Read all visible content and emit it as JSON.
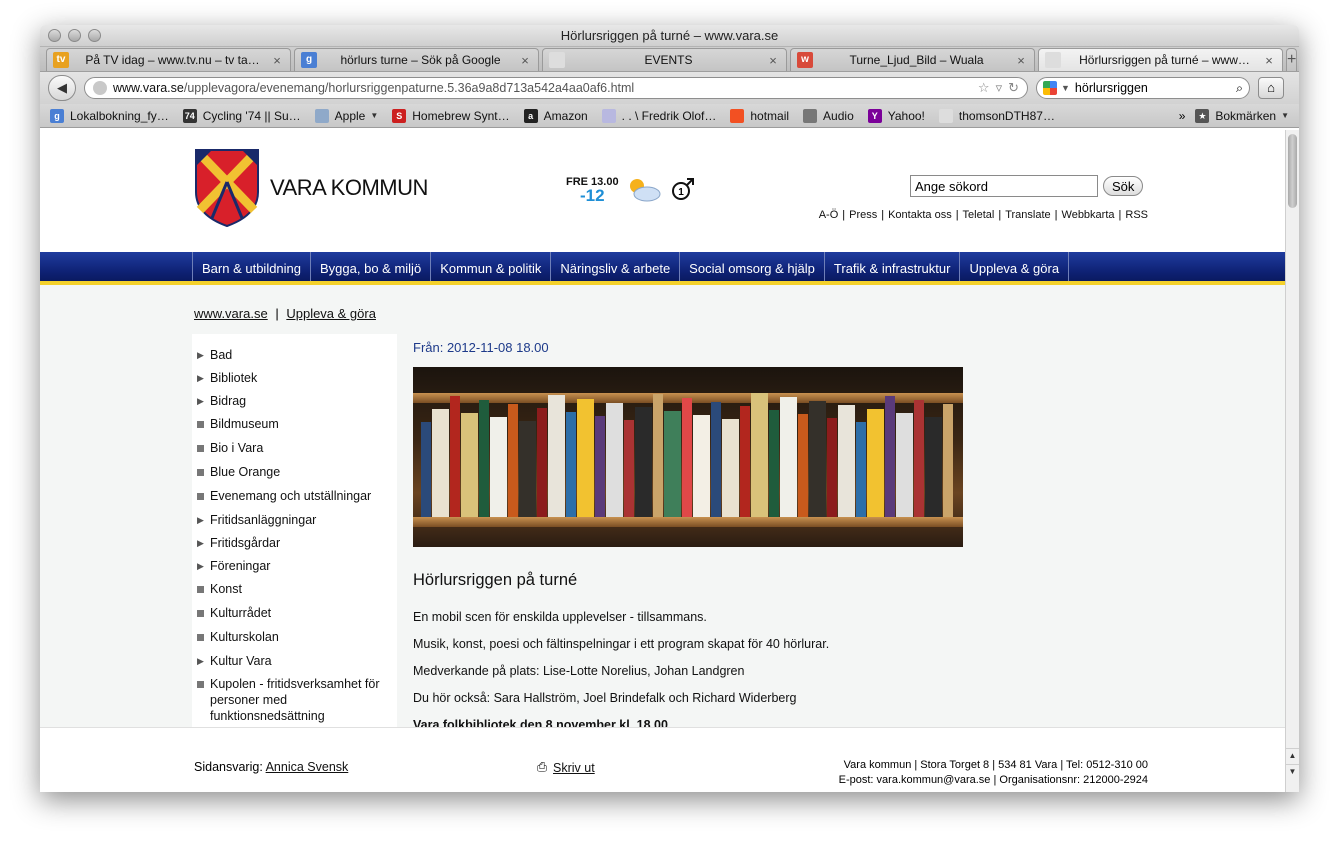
{
  "window": {
    "title": "Hörlursriggen på turné – www.vara.se"
  },
  "tabs": [
    {
      "label": "På TV idag – www.tv.nu – tv ta…",
      "icon": "tv-icon",
      "color": "#e8a120",
      "glyph": "tv"
    },
    {
      "label": "hörlurs turne – Sök på Google",
      "icon": "google-icon",
      "color": "#4a7fd4",
      "glyph": "g"
    },
    {
      "label": "EVENTS",
      "icon": "blank-page-icon",
      "color": "#dddddd",
      "glyph": ""
    },
    {
      "label": "Turne_Ljud_Bild – Wuala",
      "icon": "wuala-icon",
      "color": "#d84a3a",
      "glyph": "w"
    },
    {
      "label": "Hörlursriggen på turné – www…",
      "icon": "blank-page-icon",
      "color": "#dddddd",
      "glyph": ""
    }
  ],
  "navbar": {
    "url_host": "www.vara.se",
    "url_path": "/upplevagora/evenemang/horlursriggenpaturne.5.36a9a8d713a542a4aa0af6.html",
    "search_value": "hörlursriggen"
  },
  "bookmarks": [
    {
      "label": "Lokalbokning_fy…",
      "icon": "google-icon",
      "color": "#4a7fd4",
      "glyph": "g"
    },
    {
      "label": "Cycling '74 || Su…",
      "icon": "cycling74-icon",
      "color": "#333333",
      "glyph": "74"
    },
    {
      "label": "Apple",
      "icon": "folder-icon",
      "color": "#8fa9c9",
      "glyph": "",
      "dropdown": true
    },
    {
      "label": "Homebrew Synt…",
      "icon": "homebrew-icon",
      "color": "#cc1f1f",
      "glyph": "S"
    },
    {
      "label": "Amazon",
      "icon": "amazon-icon",
      "color": "#222222",
      "glyph": "a"
    },
    {
      "label": ". . \\ Fredrik Olof…",
      "icon": "page-icon",
      "color": "#b8b8e0",
      "glyph": ""
    },
    {
      "label": "hotmail",
      "icon": "windows-icon",
      "color": "#f25022",
      "glyph": ""
    },
    {
      "label": "Audio",
      "icon": "apple-icon",
      "color": "#777777",
      "glyph": ""
    },
    {
      "label": "Yahoo!",
      "icon": "yahoo-icon",
      "color": "#7b0099",
      "glyph": "Y"
    },
    {
      "label": "thomsonDTH87…",
      "icon": "blank-page-icon",
      "color": "#dddddd",
      "glyph": ""
    }
  ],
  "bookmarks_menu": "Bokmärken",
  "overflow": "»",
  "site": {
    "brand": "VARA KOMMUN",
    "weather": {
      "day": "FRE 13.00",
      "temp": "-12",
      "wind": "1"
    },
    "search_placeholder": "Ange sökord",
    "search_button": "Sök",
    "toplinks": [
      "A-Ö",
      "Press",
      "Kontakta oss",
      "Teletal",
      "Translate",
      "Webbkarta",
      "RSS"
    ],
    "mainnav": [
      "Barn & utbildning",
      "Bygga, bo & miljö",
      "Kommun & politik",
      "Näringsliv & arbete",
      "Social omsorg & hjälp",
      "Trafik & infrastruktur",
      "Uppleva & göra"
    ],
    "breadcrumb": {
      "home": "www.vara.se",
      "sep": "|",
      "current": "Uppleva & göra"
    },
    "leftnav": [
      {
        "label": "Bad",
        "marker": "arrow"
      },
      {
        "label": "Bibliotek",
        "marker": "arrow"
      },
      {
        "label": "Bidrag",
        "marker": "arrow"
      },
      {
        "label": "Bildmuseum",
        "marker": "square"
      },
      {
        "label": "Bio i Vara",
        "marker": "square"
      },
      {
        "label": "Blue Orange",
        "marker": "square"
      },
      {
        "label": "Evenemang och utställningar",
        "marker": "square"
      },
      {
        "label": "Fritidsanläggningar",
        "marker": "arrow"
      },
      {
        "label": "Fritidsgårdar",
        "marker": "arrow"
      },
      {
        "label": "Föreningar",
        "marker": "arrow"
      },
      {
        "label": "Konst",
        "marker": "square"
      },
      {
        "label": "Kulturrådet",
        "marker": "square"
      },
      {
        "label": "Kulturskolan",
        "marker": "square"
      },
      {
        "label": "Kultur Vara",
        "marker": "arrow"
      },
      {
        "label": "Kupolen - fritidsverksamhet för personer med funktionsnedsättning",
        "marker": "square"
      }
    ],
    "article": {
      "from": "Från: 2012-11-08 18.00",
      "heading": "Hörlursriggen på turné",
      "paragraphs": [
        "En mobil scen för enskilda upplevelser - tillsammans.",
        "Musik, konst, poesi och fältinspelningar i ett program skapat för 40 hörlurar.",
        "Medverkande på plats: Lise-Lotte Norelius, Johan Landgren",
        "Du hör också: Sara Hallström, Joel Brindefalk och Richard Widerberg"
      ],
      "highlight": "Vara folkbibliotek den 8 november kl. 18.00"
    },
    "footer": {
      "resp_label": "Sidansvarig:",
      "resp_name": "Annica Svensk",
      "print": "Skriv ut",
      "addr1": "Vara kommun | Stora Torget 8 | 534 81 Vara | Tel: 0512-310 00",
      "addr2": "E-post: vara.kommun@vara.se | Organisationsnr: 212000-2924"
    }
  }
}
